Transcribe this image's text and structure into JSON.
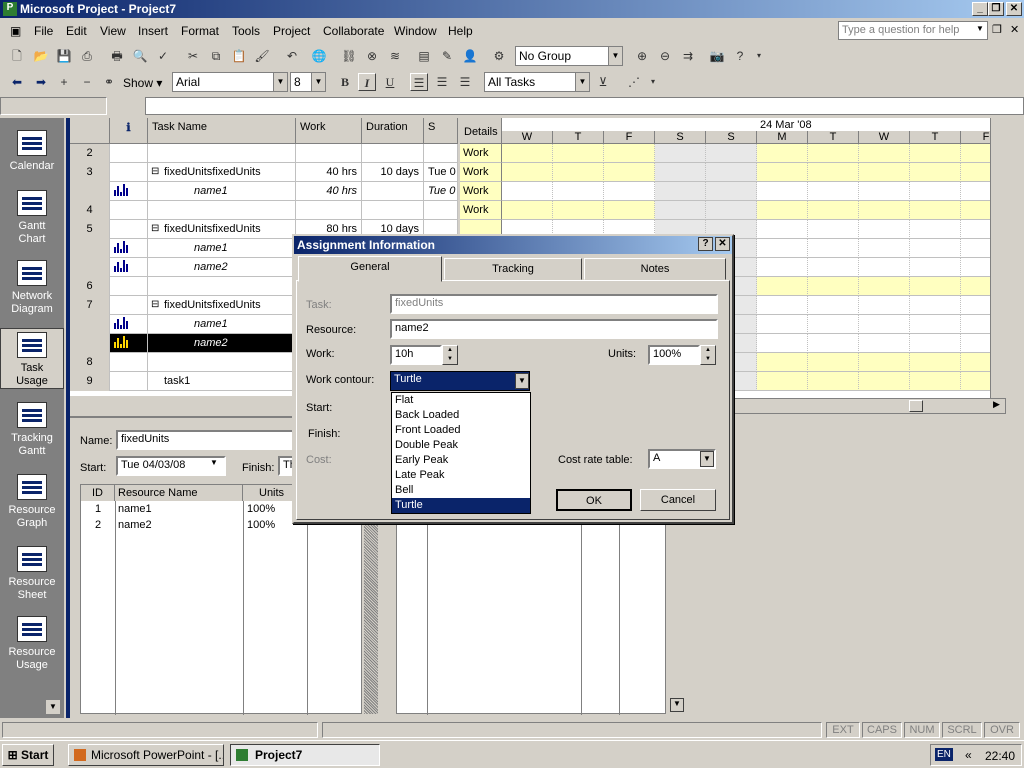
{
  "app": {
    "title": "Microsoft Project - Project7",
    "help_placeholder": "Type a question for help"
  },
  "menu": [
    "File",
    "Edit",
    "View",
    "Insert",
    "Format",
    "Tools",
    "Project",
    "Collaborate",
    "Window",
    "Help"
  ],
  "toolbar": {
    "group": "No Group",
    "show": "Show",
    "font": "Arial",
    "size": "8",
    "filter": "All Tasks",
    "bold": "B",
    "italic": "I",
    "underline": "U"
  },
  "viewbar": [
    "Calendar",
    "Gantt Chart",
    "Network Diagram",
    "Task Usage",
    "Tracking Gantt",
    "Resource Graph",
    "Resource Sheet",
    "Resource Usage"
  ],
  "grid": {
    "headers": {
      "task_name": "Task Name",
      "work": "Work",
      "duration": "Duration",
      "start": "S"
    },
    "rows": [
      {
        "id": "2",
        "name": "",
        "work": "",
        "duration": "",
        "start": ""
      },
      {
        "id": "3",
        "name": "fixedUnits",
        "work": "40 hrs",
        "duration": "10 days",
        "start": "Tue 0"
      },
      {
        "id": "",
        "name": "name1",
        "work": "40 hrs",
        "duration": "",
        "start": "Tue 0"
      },
      {
        "id": "4",
        "name": "",
        "work": "",
        "duration": "",
        "start": ""
      },
      {
        "id": "5",
        "name": "fixedUnits",
        "work": "80 hrs",
        "duration": "10 days",
        "start": ""
      },
      {
        "id": "",
        "name": "name1",
        "work": "",
        "duration": "",
        "start": ""
      },
      {
        "id": "",
        "name": "name2",
        "work": "",
        "duration": "",
        "start": ""
      },
      {
        "id": "6",
        "name": "",
        "work": "",
        "duration": "",
        "start": ""
      },
      {
        "id": "7",
        "name": "fixedUnits",
        "work": "",
        "duration": "",
        "start": ""
      },
      {
        "id": "",
        "name": "name1",
        "work": "",
        "duration": "",
        "start": ""
      },
      {
        "id": "",
        "name": "name2",
        "work": "",
        "duration": "",
        "start": ""
      },
      {
        "id": "8",
        "name": "",
        "work": "",
        "duration": "",
        "start": ""
      },
      {
        "id": "9",
        "name": "task1",
        "work": "",
        "duration": "",
        "start": ""
      }
    ]
  },
  "timescale": {
    "details": "Details",
    "week": "24 Mar '08",
    "days": [
      "W",
      "T",
      "F",
      "S",
      "S",
      "M",
      "T",
      "W",
      "T",
      "F"
    ],
    "row_label": "Work"
  },
  "form": {
    "name_label": "Name:",
    "name_value": "fixedUnits",
    "start_label": "Start:",
    "start_value": "Tue 04/03/08",
    "finish_label": "Finish:",
    "finish_value": "Th",
    "cols": {
      "id": "ID",
      "resource": "Resource Name",
      "units": "Units"
    },
    "rows": [
      {
        "id": "1",
        "resource": "name1",
        "units": "100%"
      },
      {
        "id": "2",
        "resource": "name2",
        "units": "100%"
      }
    ]
  },
  "dialog": {
    "title": "Assignment Information",
    "tabs": [
      "General",
      "Tracking",
      "Notes"
    ],
    "task_label": "Task:",
    "task_value": "fixedUnits",
    "resource_label": "Resource:",
    "resource_value": "name2",
    "work_label": "Work:",
    "work_value": "10h",
    "units_label": "Units:",
    "units_value": "100%",
    "contour_label": "Work contour:",
    "contour_value": "Turtle",
    "start_label": "Start:",
    "finish_label": "Finish:",
    "cost_label": "Cost:",
    "cost_table_label": "Cost rate table:",
    "cost_table_value": "A",
    "ok": "OK",
    "cancel": "Cancel",
    "options": [
      "Flat",
      "Back Loaded",
      "Front Loaded",
      "Double Peak",
      "Early Peak",
      "Late Peak",
      "Bell",
      "Turtle"
    ]
  },
  "status": [
    "EXT",
    "CAPS",
    "NUM",
    "SCRL",
    "OVR"
  ],
  "taskbar": {
    "start": "Start",
    "items": [
      "Microsoft PowerPoint - [...",
      "Project7"
    ],
    "lang": "EN",
    "time": "22:40"
  }
}
